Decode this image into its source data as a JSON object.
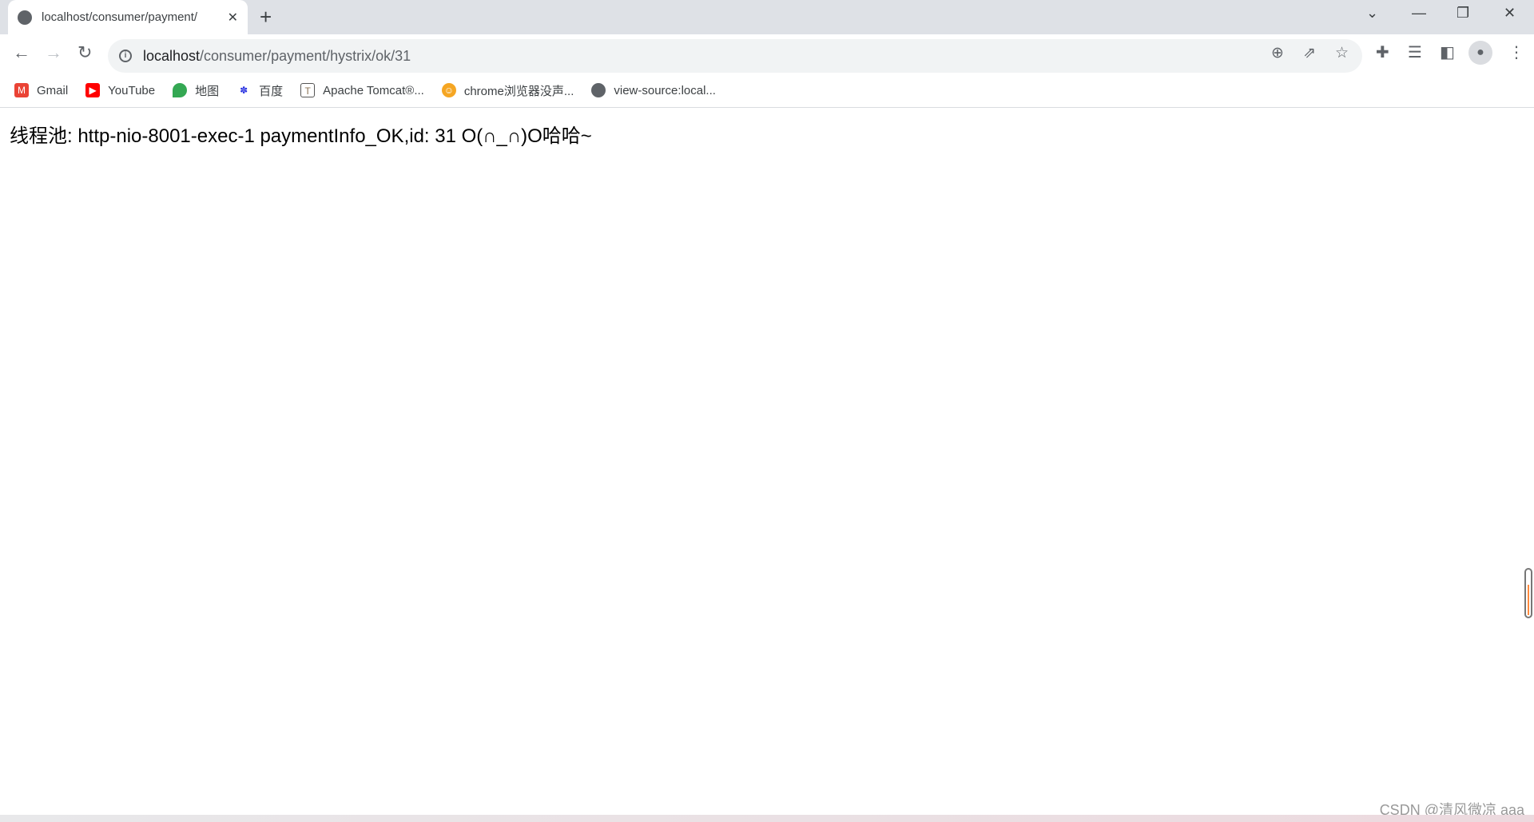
{
  "tab": {
    "title": "localhost/consumer/payment/",
    "close": "✕",
    "new_tab": "+"
  },
  "window": {
    "tab_search": "⌄",
    "minimize": "—",
    "restore": "❐",
    "close": "✕"
  },
  "nav": {
    "back": "←",
    "forward": "→",
    "reload": "↻"
  },
  "address": {
    "host": "localhost",
    "path": "/consumer/payment/hystrix/ok/31"
  },
  "bookmarks": [
    {
      "label": "Gmail",
      "icon": "gmail-icon",
      "color": "#ea4335",
      "glyph": "M"
    },
    {
      "label": "YouTube",
      "icon": "youtube-icon",
      "color": "#ff0000",
      "glyph": "▶"
    },
    {
      "label": "地图",
      "icon": "maps-icon",
      "color": "#34a853",
      "glyph": "●"
    },
    {
      "label": "百度",
      "icon": "baidu-icon",
      "color": "#2932e1",
      "glyph": "✽"
    },
    {
      "label": "Apache Tomcat®...",
      "icon": "tomcat-icon",
      "color": "#8b7355",
      "glyph": "T"
    },
    {
      "label": "chrome浏览器没声...",
      "icon": "site-icon",
      "color": "#f5a623",
      "glyph": "☺"
    },
    {
      "label": "view-source:local...",
      "icon": "globe-icon",
      "color": "#5f6368",
      "glyph": "●"
    }
  ],
  "page": {
    "text": "线程池: http-nio-8001-exec-1 paymentInfo_OK,id: 31 O(∩_∩)O哈哈~"
  },
  "watermark": "CSDN @清风微凉 aaa"
}
